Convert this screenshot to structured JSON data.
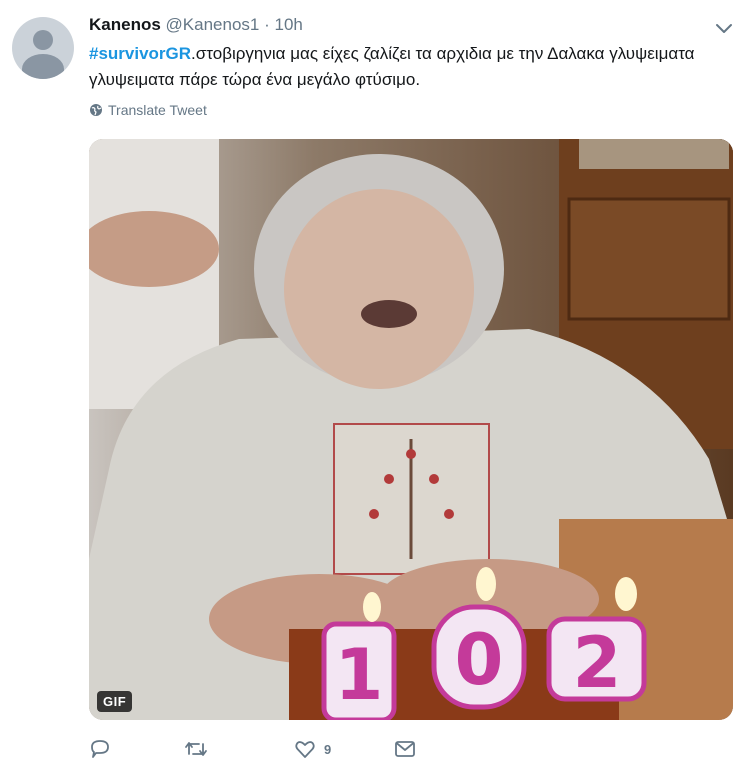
{
  "tweet": {
    "author_name": "Kanenos",
    "author_handle": "@Kanenos1",
    "separator": "·",
    "timestamp": "10h",
    "hashtag": "#survivorGR",
    "text": ".στοβιργηνια μας είχες ζαλίζει τα αρχιδια με την Δαλακα γλυψειματα γλυψειματα πάρε τώρα ένα μεγάλο φτύσιμο.",
    "translate_label": "Translate Tweet",
    "media": {
      "badge": "GIF",
      "candle_digits": [
        "1",
        "0",
        "2"
      ]
    },
    "actions": {
      "reply_count": "",
      "retweet_count": "",
      "like_count": "9"
    }
  },
  "colors": {
    "link": "#1b95e0",
    "muted": "#657786",
    "text": "#14171a"
  },
  "icons": [
    "avatar-default-icon",
    "chevron-down-icon",
    "globe-icon",
    "reply-icon",
    "retweet-icon",
    "like-icon",
    "message-icon"
  ]
}
